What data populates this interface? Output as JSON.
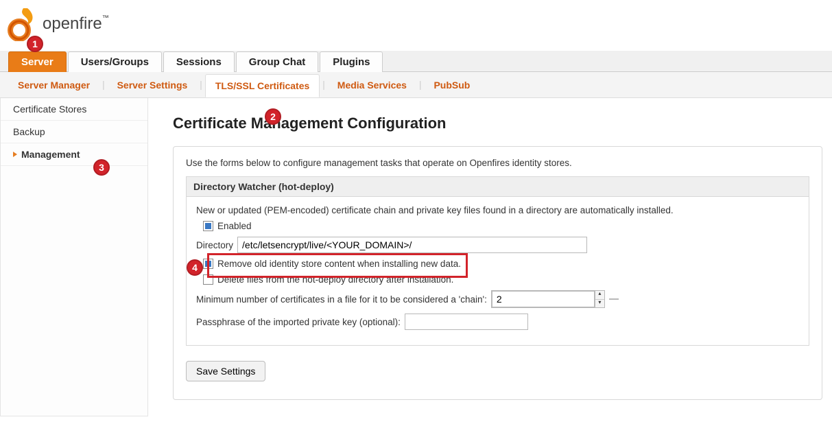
{
  "brand": {
    "name": "openfire",
    "tm": "™"
  },
  "tabs": [
    {
      "label": "Server",
      "active": true
    },
    {
      "label": "Users/Groups"
    },
    {
      "label": "Sessions"
    },
    {
      "label": "Group Chat"
    },
    {
      "label": "Plugins"
    }
  ],
  "subtabs": [
    {
      "label": "Server Manager"
    },
    {
      "label": "Server Settings"
    },
    {
      "label": "TLS/SSL Certificates",
      "active": true
    },
    {
      "label": "Media Services"
    },
    {
      "label": "PubSub"
    }
  ],
  "sidebar": [
    {
      "label": "Certificate Stores"
    },
    {
      "label": "Backup"
    },
    {
      "label": "Management",
      "active": true
    }
  ],
  "page": {
    "title": "Certificate Management Configuration",
    "intro": "Use the forms below to configure management tasks that operate on Openfires identity stores.",
    "group_title": "Directory Watcher (hot-deploy)",
    "group_intro": "New or updated (PEM-encoded) certificate chain and private key files found in a directory are automatically installed.",
    "enabled": {
      "label": "Enabled",
      "checked": true
    },
    "directory": {
      "label": "Directory",
      "value": "/etc/letsencrypt/live/<YOUR_DOMAIN>/"
    },
    "remove_old": {
      "label": "Remove old identity store content when installing new data.",
      "checked": true
    },
    "delete_files": {
      "label": "Delete files from the hot-deploy directory after installation.",
      "checked": false
    },
    "min_chain": {
      "label": "Minimum number of certificates in a file for it to be considered a 'chain':",
      "value": "2"
    },
    "passphrase": {
      "label": "Passphrase of the imported private key (optional):",
      "value": ""
    },
    "save": "Save Settings"
  },
  "callouts": {
    "1": "1",
    "2": "2",
    "3": "3",
    "4": "4"
  }
}
